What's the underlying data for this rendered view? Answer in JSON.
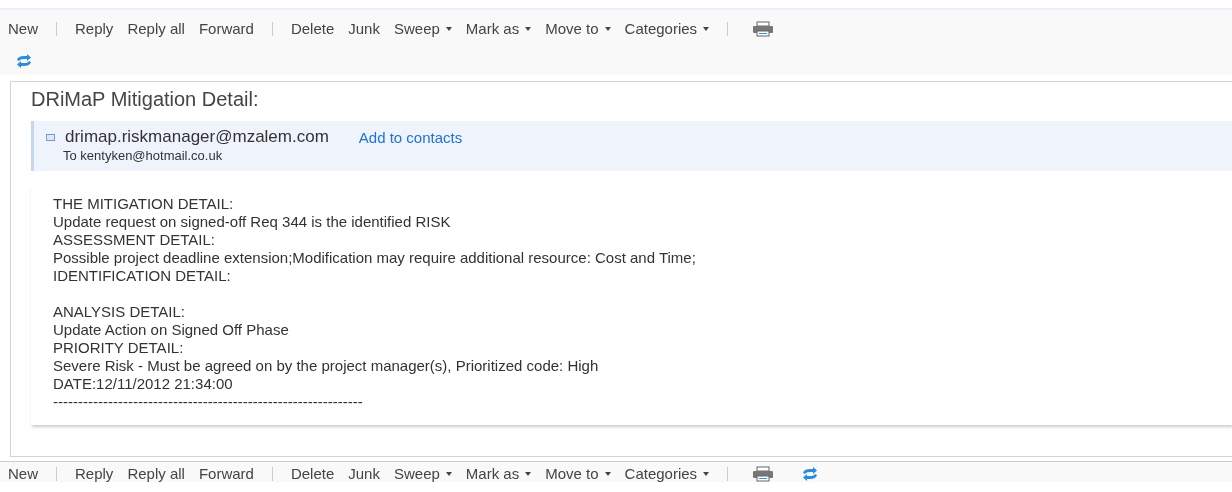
{
  "top_toolbar": {
    "items": [
      {
        "kind": "button",
        "label": "New"
      },
      {
        "kind": "separator"
      },
      {
        "kind": "button",
        "label": "Reply"
      },
      {
        "kind": "button",
        "label": "Reply all"
      },
      {
        "kind": "button",
        "label": "Forward"
      },
      {
        "kind": "separator"
      },
      {
        "kind": "button",
        "label": "Delete"
      },
      {
        "kind": "button",
        "label": "Junk"
      },
      {
        "kind": "menu",
        "label": "Sweep"
      },
      {
        "kind": "menu",
        "label": "Mark as"
      },
      {
        "kind": "menu",
        "label": "Move to"
      },
      {
        "kind": "menu",
        "label": "Categories"
      },
      {
        "kind": "separator"
      },
      {
        "kind": "print"
      },
      {
        "kind": "break"
      },
      {
        "kind": "refresh"
      }
    ]
  },
  "message": {
    "subject": "DRiMaP Mitigation Detail:",
    "sender": "drimap.riskmanager@mzalem.com",
    "add_contact": "Add to contacts",
    "recipient": "To kentyken@hotmail.co.uk",
    "body": [
      [
        "THE MITIGATION DETAIL:",
        "Update request on signed-off Req 344 is the identified RISK",
        "ASSESSMENT DETAIL:",
        "Possible project deadline extension;Modification may require additional resource: Cost and Time;",
        "IDENTIFICATION DETAIL:"
      ],
      [
        "ANALYSIS DETAIL:",
        "Update Action on Signed Off Phase",
        "PRIORITY DETAIL:",
        "Severe Risk - Must be agreed on by the project manager(s), Prioritized code: High",
        "DATE:12/11/2012 21:34:00",
        "--------------------------------------------------------------"
      ]
    ]
  },
  "bottom_toolbar": {
    "items": [
      {
        "kind": "button",
        "label": "New"
      },
      {
        "kind": "separator"
      },
      {
        "kind": "button",
        "label": "Reply"
      },
      {
        "kind": "button",
        "label": "Reply all"
      },
      {
        "kind": "button",
        "label": "Forward"
      },
      {
        "kind": "separator"
      },
      {
        "kind": "button",
        "label": "Delete"
      },
      {
        "kind": "button",
        "label": "Junk"
      },
      {
        "kind": "menu",
        "label": "Sweep"
      },
      {
        "kind": "menu",
        "label": "Mark as"
      },
      {
        "kind": "menu",
        "label": "Move to"
      },
      {
        "kind": "menu",
        "label": "Categories"
      },
      {
        "kind": "separator"
      },
      {
        "kind": "print"
      },
      {
        "kind": "refresh"
      }
    ]
  }
}
